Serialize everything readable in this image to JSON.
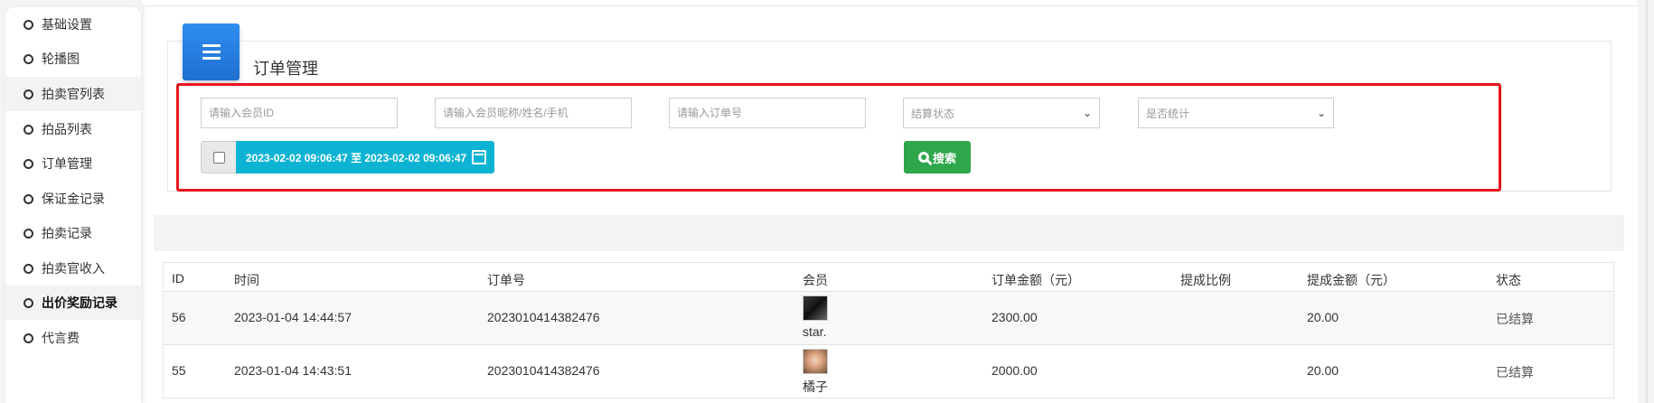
{
  "sidebar": {
    "items": [
      {
        "label": "基础设置"
      },
      {
        "label": "轮播图"
      },
      {
        "label": "拍卖官列表"
      },
      {
        "label": "拍品列表"
      },
      {
        "label": "订单管理"
      },
      {
        "label": "保证金记录"
      },
      {
        "label": "拍卖记录"
      },
      {
        "label": "拍卖官收入"
      },
      {
        "label": "出价奖励记录"
      },
      {
        "label": "代言费"
      }
    ]
  },
  "card": {
    "title": "订单管理",
    "icon": "hamburger-menu-icon"
  },
  "filters": {
    "member_id_placeholder": "请输入会员ID",
    "member_info_placeholder": "请输入会员昵称/姓名/手机",
    "order_no_placeholder": "请输入订单号",
    "settle_status": "结算状态",
    "is_counted": "是否统计",
    "date_range": "2023-02-02 09:06:47 至 2023-02-02 09:06:47",
    "search_label": "搜索"
  },
  "table": {
    "headers": [
      "ID",
      "时间",
      "订单号",
      "会员",
      "订单金额（元）",
      "提成比例",
      "提成金额（元）",
      "状态"
    ],
    "rows": [
      {
        "id": "56",
        "time": "2023-01-04 14:44:57",
        "order_no": "2023010414382476",
        "member": "star.",
        "amount": "2300.00",
        "ratio": "",
        "commission": "20.00",
        "status": "已结算"
      },
      {
        "id": "55",
        "time": "2023-01-04 14:43:51",
        "order_no": "2023010414382476",
        "member": "橘子",
        "amount": "2000.00",
        "ratio": "",
        "commission": "20.00",
        "status": "已结算"
      }
    ]
  },
  "colors": {
    "accent_blue": "#1f6fd0",
    "date_cyan": "#0db3d3",
    "search_green": "#2ea64a",
    "highlight_red": "#e8141b"
  }
}
